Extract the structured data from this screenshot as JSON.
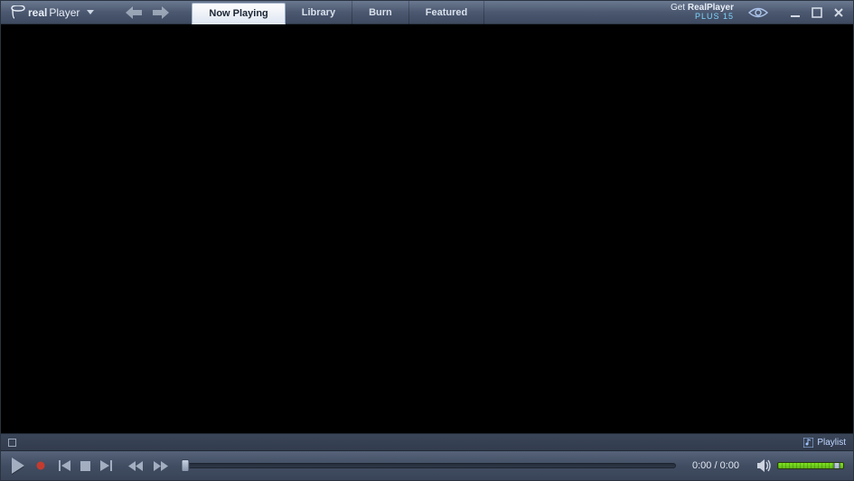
{
  "app": {
    "brand_prefix": "real",
    "brand_suffix": "Player"
  },
  "tabs": [
    {
      "label": "Now Playing",
      "active": true
    },
    {
      "label": "Library",
      "active": false
    },
    {
      "label": "Burn",
      "active": false
    },
    {
      "label": "Featured",
      "active": false
    }
  ],
  "promo": {
    "line1_pre": "Get ",
    "line1_bold": "RealPlayer",
    "line2": "PLUS 15"
  },
  "infobar": {
    "playlist_label": "Playlist"
  },
  "playback": {
    "time_display": "0:00 / 0:00",
    "progress_pct": 0,
    "volume_pct": 90
  },
  "icons": {
    "menu": "menu-dropdown-icon",
    "back": "back-arrow-icon",
    "forward": "forward-arrow-icon",
    "eye": "eye-icon",
    "minimize": "minimize-icon",
    "maximize": "maximize-icon",
    "close": "close-icon",
    "stop_indicator": "stop-indicator-icon",
    "playlist": "playlist-icon",
    "play": "play-icon",
    "record": "record-icon",
    "prev": "previous-track-icon",
    "stop": "stop-icon",
    "next": "next-track-icon",
    "rewind": "rewind-icon",
    "fastforward": "fast-forward-icon",
    "speaker": "speaker-icon"
  },
  "colors": {
    "chrome_top": "#6a7890",
    "chrome_bottom": "#394458",
    "accent_blue": "#7fd6ff",
    "volume_green": "#7fe51f"
  }
}
